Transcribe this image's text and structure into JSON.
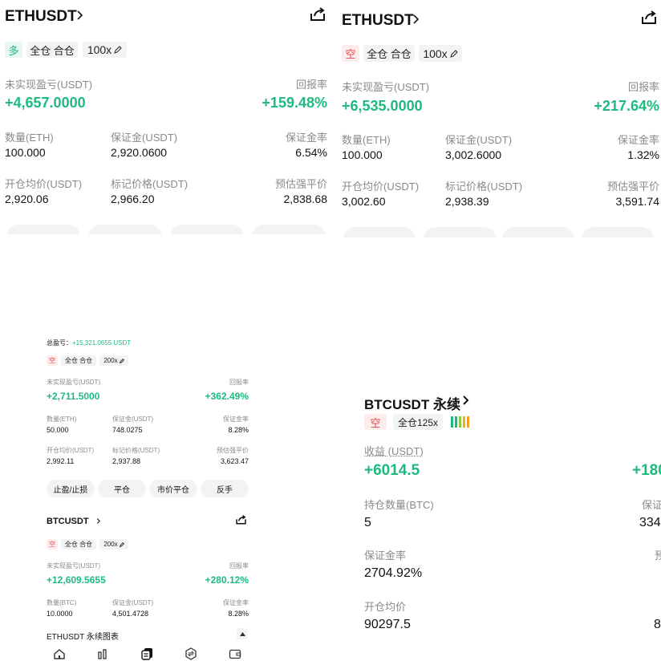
{
  "panel_a": {
    "symbol": "ETHUSDT",
    "side": "多",
    "margin_mode": "全仓 合仓",
    "leverage": "100x",
    "pnl_label": "未实现盈亏(USDT)",
    "pnl_value": "+4,657.0000",
    "roe_label": "回报率",
    "roe_value": "+159.48%",
    "qty_label": "数量(ETH)",
    "qty_value": "100.000",
    "margin_label": "保证金(USDT)",
    "margin_value": "2,920.0600",
    "margin_rate_label": "保证金率",
    "margin_rate_value": "6.54%",
    "entry_label": "开仓均价(USDT)",
    "entry_value": "2,920.06",
    "mark_label": "标记价格(USDT)",
    "mark_value": "2,966.20",
    "liq_label": "预估强平价",
    "liq_value": "2,838.68"
  },
  "panel_b": {
    "symbol": "ETHUSDT",
    "side": "空",
    "margin_mode": "全仓 合仓",
    "leverage": "100x",
    "pnl_label": "未实现盈亏(USDT)",
    "pnl_value": "+6,535.0000",
    "roe_label": "回报率",
    "roe_value": "+217.64%",
    "qty_label": "数量(ETH)",
    "qty_value": "100.000",
    "margin_label": "保证金(USDT)",
    "margin_value": "3,002.6000",
    "margin_rate_label": "保证金率",
    "margin_rate_value": "1.32%",
    "entry_label": "开仓均价(USDT)",
    "entry_value": "3,002.60",
    "mark_label": "标记价格(USDT)",
    "mark_value": "2,938.39",
    "liq_label": "预估强平价",
    "liq_value": "3,591.74"
  },
  "panel_c": {
    "total_label": "总盈亏：",
    "total_value": "+15,321.0655 USDT",
    "pos1": {
      "side": "空",
      "margin_mode": "全仓 合仓",
      "leverage": "200x",
      "pnl_label": "未实现盈亏(USDT)",
      "pnl_value": "+2,711.5000",
      "roe_label": "回报率",
      "roe_value": "+362.49%",
      "qty_label": "数量(ETH)",
      "qty_value": "50.000",
      "margin_label": "保证金(USDT)",
      "margin_value": "748.0275",
      "margin_rate_label": "保证金率",
      "margin_rate_value": "8.28%",
      "entry_label": "开仓均价(USDT)",
      "entry_value": "2,992.11",
      "mark_label": "标记价格(USDT)",
      "mark_value": "2,937.88",
      "liq_label": "预估强平价",
      "liq_value": "3,623.47"
    },
    "buttons": [
      "止盈/止损",
      "平仓",
      "市价平仓",
      "反手"
    ],
    "pos2": {
      "symbol": "BTCUSDT",
      "side": "空",
      "margin_mode": "全仓 合仓",
      "leverage": "200x",
      "pnl_label": "未实现盈亏(USDT)",
      "pnl_value": "+12,609.5655",
      "roe_label": "回报率",
      "roe_value": "+280.12%",
      "qty_label": "数量(BTC)",
      "qty_value": "10.0000",
      "margin_label": "保证金(USDT)",
      "margin_value": "4,501.4728",
      "margin_rate_label": "保证金率",
      "margin_rate_value": "8.28%"
    },
    "chart_link": "ETHUSDT 永续图表",
    "nav_icons": [
      "home-icon",
      "market-icon",
      "trade-icon",
      "futures-icon",
      "wallet-icon"
    ]
  },
  "panel_d": {
    "symbol": "BTCUSDT 永续",
    "side": "空",
    "margin_mode": "全仓125x",
    "pnl_label": "收益 (USDT)",
    "pnl_value": "+6014.5",
    "roe_partial": "+180",
    "qty_label": "持仓数量(BTC)",
    "qty_value": "5",
    "margin_partial_label": "保证",
    "margin_partial_value": "334",
    "margin_rate_label": "保证金率",
    "margin_rate_value": "2704.92%",
    "liq_partial_label": "预",
    "entry_label": "开仓均价",
    "entry_value": "90297.5",
    "mark_partial_value": "8"
  },
  "colors": {
    "green": "#1dba7f",
    "red": "#e0474c",
    "grey": "#8a8a8a",
    "chip_bg": "#f2f3f5"
  }
}
